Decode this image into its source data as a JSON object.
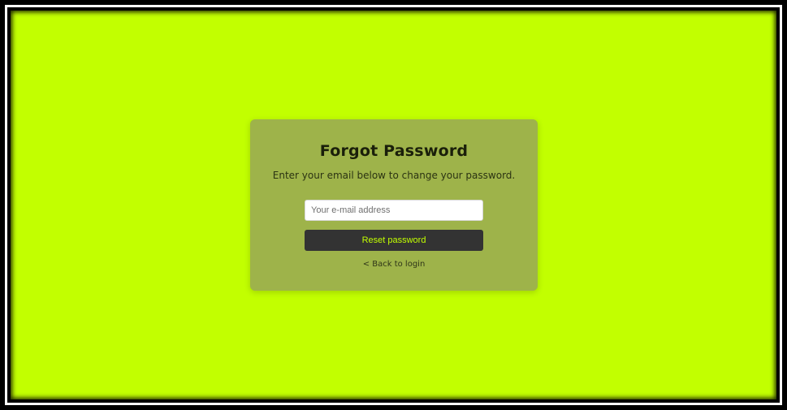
{
  "page": {
    "background_color": "#c2ff00",
    "frame_color": "#000000"
  },
  "card": {
    "title": "Forgot Password",
    "subtitle": "Enter your email below to change your password.",
    "background_color": "#9eb34a"
  },
  "form": {
    "email_value": "",
    "email_placeholder": "Your e-mail address",
    "submit_label": "Reset password",
    "submit_bg_color": "#333333",
    "submit_text_color": "#c2ff00"
  },
  "links": {
    "back_to_login": "< Back to login"
  }
}
